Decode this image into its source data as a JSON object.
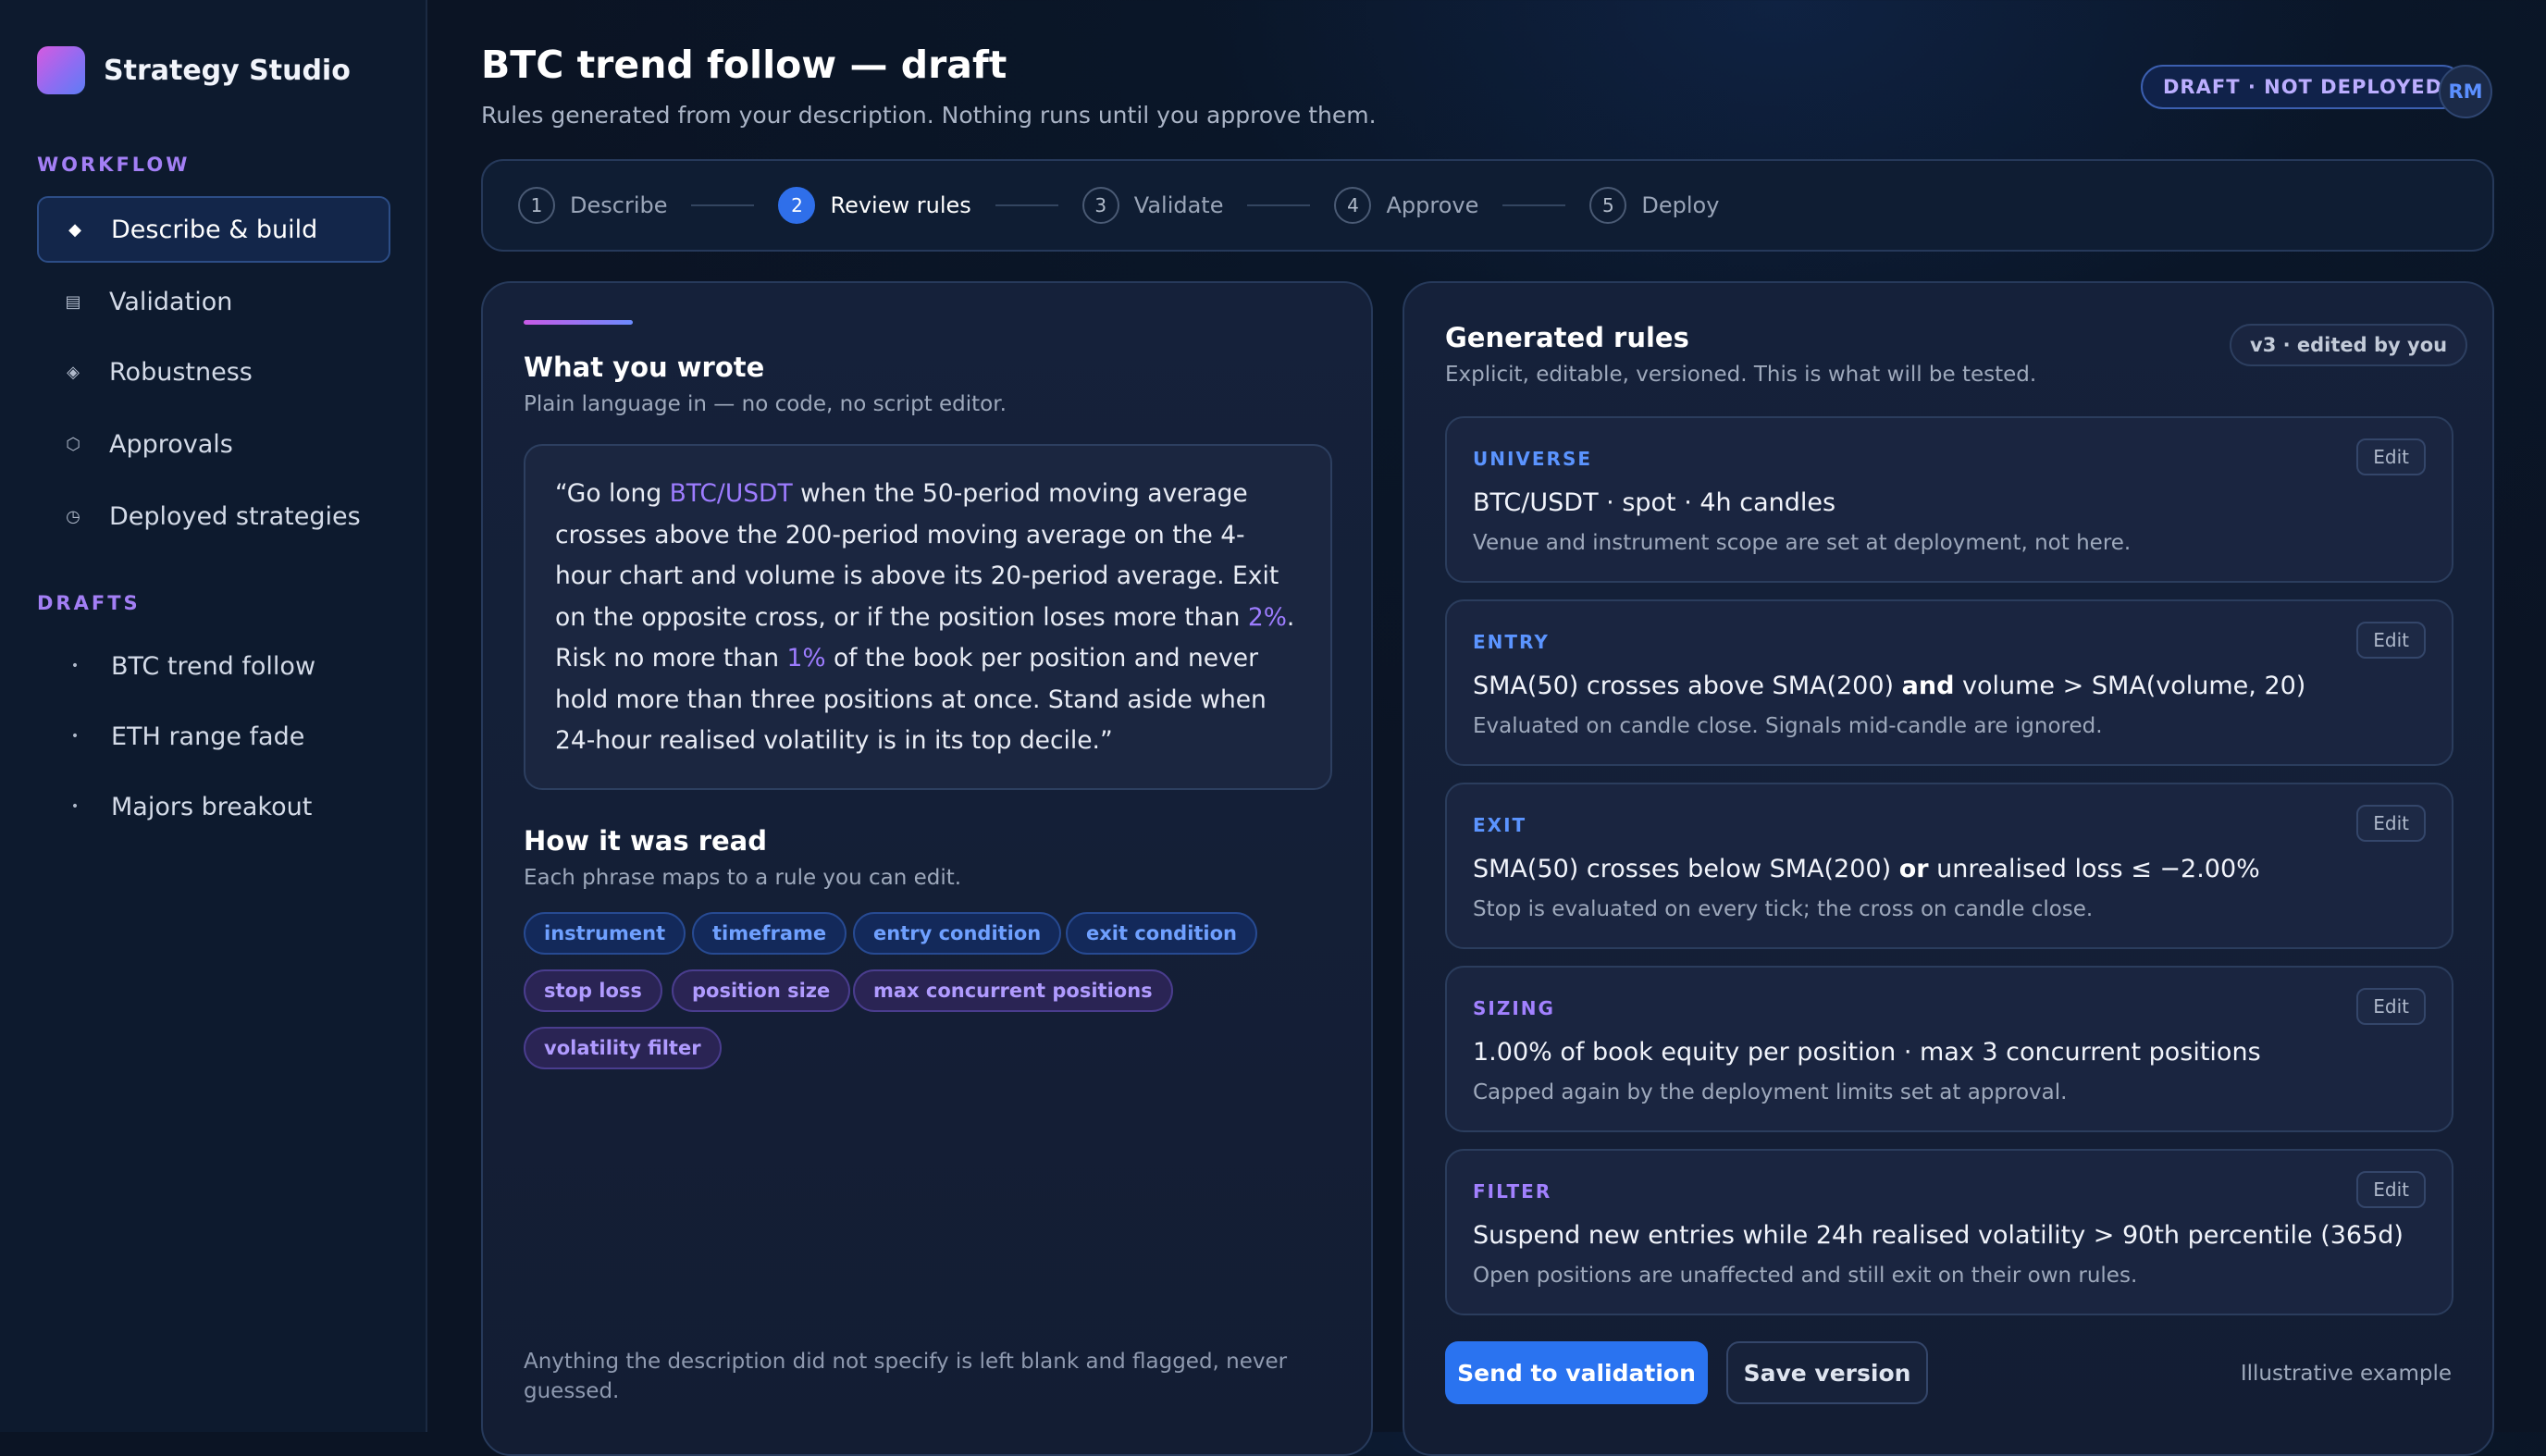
{
  "brand": {
    "name": "Strategy Studio"
  },
  "sidebar": {
    "workflow_label": "WORKFLOW",
    "workflow": [
      {
        "label": "Describe & build",
        "icon": "diamond-icon",
        "glyph": "◆",
        "active": true
      },
      {
        "label": "Validation",
        "icon": "list-icon",
        "glyph": "▤",
        "active": false
      },
      {
        "label": "Robustness",
        "icon": "layers-icon",
        "glyph": "◈",
        "active": false
      },
      {
        "label": "Approvals",
        "icon": "hexagon-icon",
        "glyph": "⬡",
        "active": false
      },
      {
        "label": "Deployed strategies",
        "icon": "clock-icon",
        "glyph": "◷",
        "active": false
      }
    ],
    "drafts_label": "DRAFTS",
    "drafts": [
      {
        "label": "BTC trend follow",
        "glyph": "•"
      },
      {
        "label": "ETH range fade",
        "glyph": "•"
      },
      {
        "label": "Majors breakout",
        "glyph": "•"
      }
    ]
  },
  "header": {
    "title": "BTC trend follow — draft",
    "subtitle": "Rules generated from your description. Nothing runs until you approve them.",
    "status_badge": "DRAFT · NOT DEPLOYED",
    "avatar_initials": "RM"
  },
  "stepper": {
    "current_step": 2,
    "steps": [
      {
        "num": "1",
        "label": "Describe"
      },
      {
        "num": "2",
        "label": "Review rules"
      },
      {
        "num": "3",
        "label": "Validate"
      },
      {
        "num": "4",
        "label": "Approve"
      },
      {
        "num": "5",
        "label": "Deploy"
      }
    ]
  },
  "left": {
    "heading": "What you wrote",
    "subheading": "Plain language in — no code, no script editor.",
    "quote": {
      "p1": "“Go long ",
      "h1": "BTC/USDT",
      "p2": " when the 50-period moving average crosses above the 200-period moving average on the 4-hour chart and volume is above its 20-period average. Exit on the opposite cross, or if the position loses more than ",
      "h2": "2%",
      "p3": ". Risk no more than ",
      "h3": "1%",
      "p4": " of the book per position and never hold more than three positions at once. Stand aside when 24-hour realised volatility is in its top decile.”"
    },
    "read_heading": "How it was read",
    "read_subheading": "Each phrase maps to a rule you can edit.",
    "chips": [
      {
        "label": "instrument",
        "tone": "blue"
      },
      {
        "label": "timeframe",
        "tone": "blue"
      },
      {
        "label": "entry condition",
        "tone": "blue"
      },
      {
        "label": "exit condition",
        "tone": "blue"
      },
      {
        "label": "stop loss",
        "tone": "purple"
      },
      {
        "label": "position size",
        "tone": "purple"
      },
      {
        "label": "max concurrent positions",
        "tone": "purple"
      },
      {
        "label": "volatility filter",
        "tone": "purple"
      }
    ],
    "footnote": "Anything the description did not specify is left blank and flagged, never guessed."
  },
  "right": {
    "heading": "Generated rules",
    "subheading": "Explicit, editable, versioned. This is what will be tested.",
    "version_badge": "v3 · edited by you",
    "edit_label": "Edit",
    "rules": [
      {
        "label": "UNIVERSE",
        "tone": "blue",
        "main_a": "BTC/USDT · spot · 4h candles",
        "bold": "",
        "main_b": "",
        "sub": "Venue and instrument scope are set at deployment, not here."
      },
      {
        "label": "ENTRY",
        "tone": "blue",
        "main_a": "SMA(50) crosses above SMA(200) ",
        "bold": "and",
        "main_b": " volume > SMA(volume, 20)",
        "sub": "Evaluated on candle close. Signals mid-candle are ignored."
      },
      {
        "label": "EXIT",
        "tone": "blue",
        "main_a": "SMA(50) crosses below SMA(200) ",
        "bold": "or",
        "main_b": " unrealised loss ≤ −2.00%",
        "sub": "Stop is evaluated on every tick; the cross on candle close."
      },
      {
        "label": "SIZING",
        "tone": "purple",
        "main_a": "1.00% of book equity per position · max 3 concurrent positions",
        "bold": "",
        "main_b": "",
        "sub": "Capped again by the deployment limits set at approval."
      },
      {
        "label": "FILTER",
        "tone": "purple",
        "main_a": "Suspend new entries while 24h realised volatility > 90th percentile (365d)",
        "bold": "",
        "main_b": "",
        "sub": "Open positions are unaffected and still exit on their own rules."
      }
    ],
    "primary_button": "Send to validation",
    "secondary_button": "Save version",
    "note": "Illustrative example"
  }
}
